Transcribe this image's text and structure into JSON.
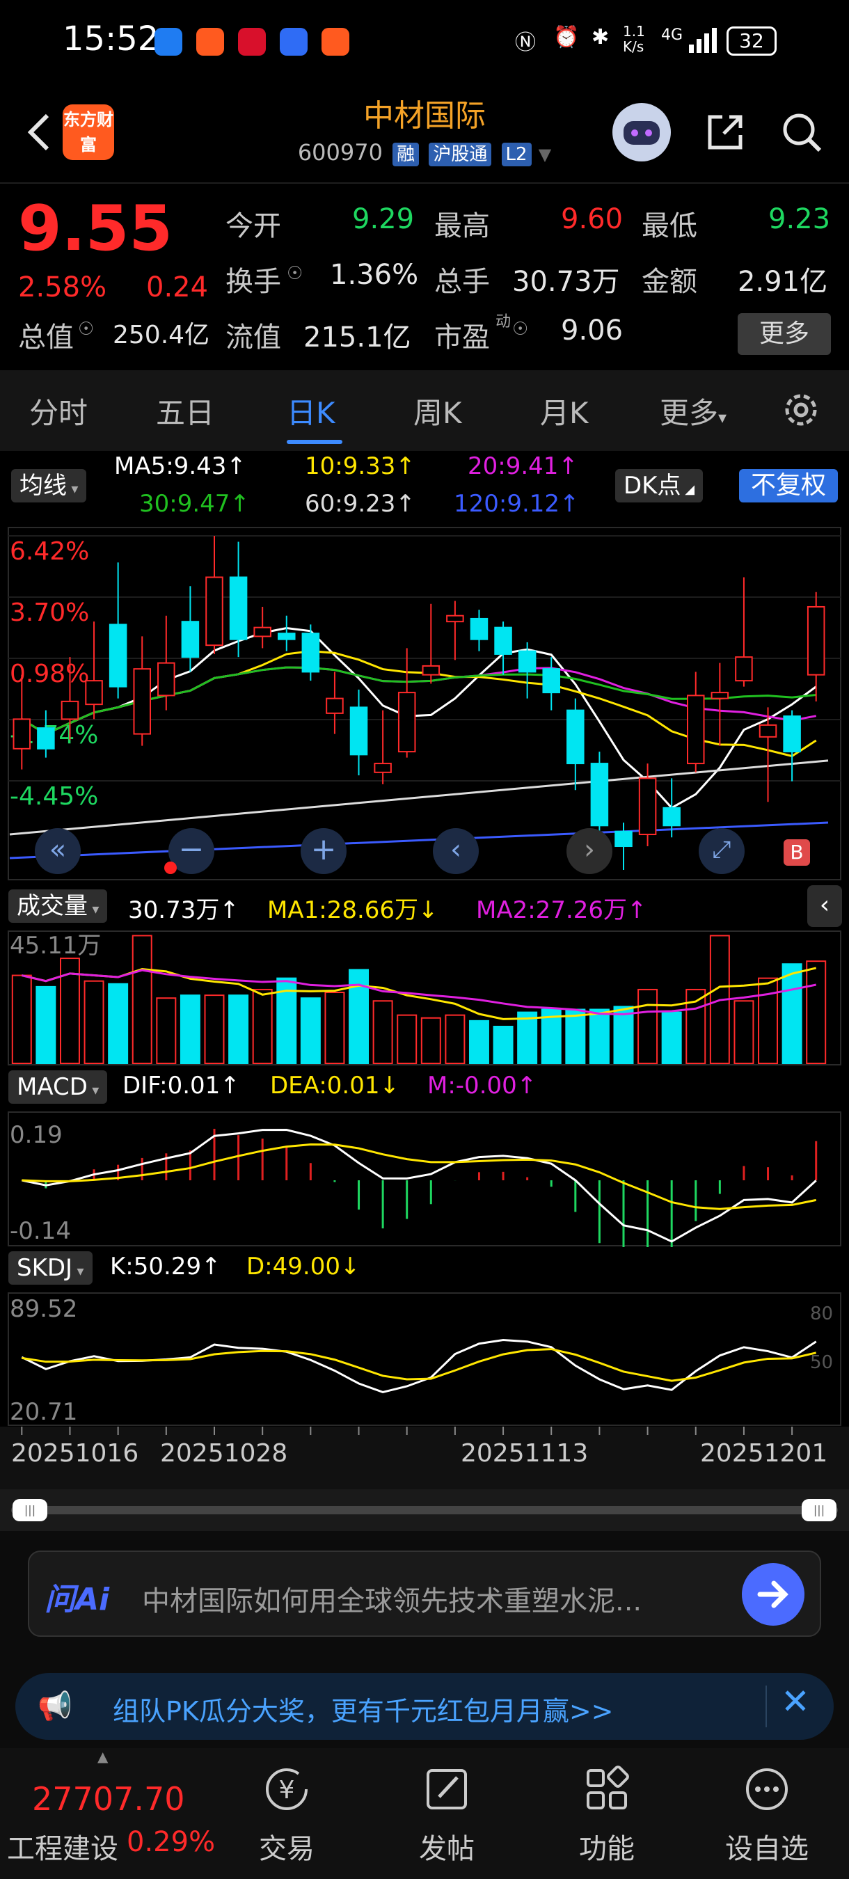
{
  "status": {
    "time": "15:52",
    "speed": "1.1\nK/s",
    "network": "4G",
    "battery": "32"
  },
  "header": {
    "logo_text": "东方财富",
    "title": "中材国际",
    "code": "600970",
    "tags": [
      "融",
      "沪股通",
      "L2"
    ]
  },
  "quote": {
    "price": "9.55",
    "change_pct": "2.58%",
    "change": "0.24",
    "open_label": "今开",
    "open": "9.29",
    "high_label": "最高",
    "high": "9.60",
    "low_label": "最低",
    "low": "9.23",
    "turnover_label": "换手",
    "turnover": "1.36%",
    "volume_label": "总手",
    "volume": "30.73万",
    "amount_label": "金额",
    "amount": "2.91亿",
    "mktcap_label": "总值",
    "mktcap": "250.4亿",
    "float_label": "流值",
    "float": "215.1亿",
    "pe_label": "市盈",
    "pe_sup": "动",
    "pe": "9.06",
    "more": "更多"
  },
  "tabs": [
    "分时",
    "五日",
    "日K",
    "周K",
    "月K",
    "更多"
  ],
  "ma": {
    "selector": "均线",
    "ma5": "MA5:9.43↑",
    "ma10": "10:9.33↑",
    "ma20": "20:9.41↑",
    "ma30": "30:9.47↑",
    "ma60": "60:9.23↑",
    "ma120": "120:9.12↑",
    "dk": "DK点",
    "fq": "不复权"
  },
  "kline": {
    "ylabels": [
      "6.42%",
      "3.70%",
      "0.98%",
      "-1.74%",
      "-4.45%"
    ],
    "candles": [
      {
        "o": 9.07,
        "c": 9.17,
        "h": 9.32,
        "l": 9.0
      },
      {
        "o": 9.14,
        "c": 9.07,
        "h": 9.2,
        "l": 9.04
      },
      {
        "o": 9.17,
        "c": 9.23,
        "h": 9.38,
        "l": 9.1
      },
      {
        "o": 9.22,
        "c": 9.3,
        "h": 9.5,
        "l": 9.17
      },
      {
        "o": 9.49,
        "c": 9.28,
        "h": 9.7,
        "l": 9.24
      },
      {
        "o": 9.12,
        "c": 9.34,
        "h": 9.45,
        "l": 9.08
      },
      {
        "o": 9.25,
        "c": 9.36,
        "h": 9.52,
        "l": 9.2
      },
      {
        "o": 9.5,
        "c": 9.38,
        "h": 9.62,
        "l": 9.33
      },
      {
        "o": 9.42,
        "c": 9.65,
        "h": 9.79,
        "l": 9.39
      },
      {
        "o": 9.65,
        "c": 9.44,
        "h": 9.77,
        "l": 9.38
      },
      {
        "o": 9.45,
        "c": 9.48,
        "h": 9.55,
        "l": 9.41
      },
      {
        "o": 9.46,
        "c": 9.44,
        "h": 9.52,
        "l": 9.4
      },
      {
        "o": 9.46,
        "c": 9.33,
        "h": 9.49,
        "l": 9.3
      },
      {
        "o": 9.19,
        "c": 9.24,
        "h": 9.33,
        "l": 9.12
      },
      {
        "o": 9.21,
        "c": 9.05,
        "h": 9.27,
        "l": 8.98
      },
      {
        "o": 8.99,
        "c": 9.02,
        "h": 9.2,
        "l": 8.95
      },
      {
        "o": 9.06,
        "c": 9.26,
        "h": 9.41,
        "l": 9.04
      },
      {
        "o": 9.32,
        "c": 9.35,
        "h": 9.56,
        "l": 9.29
      },
      {
        "o": 9.5,
        "c": 9.52,
        "h": 9.57,
        "l": 9.37
      },
      {
        "o": 9.51,
        "c": 9.44,
        "h": 9.54,
        "l": 9.4
      },
      {
        "o": 9.48,
        "c": 9.39,
        "h": 9.5,
        "l": 9.32
      },
      {
        "o": 9.4,
        "c": 9.33,
        "h": 9.43,
        "l": 9.24
      },
      {
        "o": 9.34,
        "c": 9.26,
        "h": 9.38,
        "l": 9.2
      },
      {
        "o": 9.2,
        "c": 9.02,
        "h": 9.24,
        "l": 8.93
      },
      {
        "o": 9.02,
        "c": 8.81,
        "h": 9.06,
        "l": 8.72
      },
      {
        "o": 8.79,
        "c": 8.74,
        "h": 8.82,
        "l": 8.66
      },
      {
        "o": 8.78,
        "c": 8.97,
        "h": 9.02,
        "l": 8.74
      },
      {
        "o": 8.87,
        "c": 8.81,
        "h": 8.97,
        "l": 8.77
      },
      {
        "o": 9.02,
        "c": 9.25,
        "h": 9.33,
        "l": 8.99
      },
      {
        "o": 9.24,
        "c": 9.26,
        "h": 9.36,
        "l": 9.08
      },
      {
        "o": 9.3,
        "c": 9.38,
        "h": 9.65,
        "l": 9.28
      },
      {
        "o": 9.11,
        "c": 9.15,
        "h": 9.21,
        "l": 8.89
      },
      {
        "o": 9.18,
        "c": 9.06,
        "h": 9.2,
        "l": 8.96
      },
      {
        "o": 9.32,
        "c": 9.55,
        "h": 9.6,
        "l": 9.23
      }
    ],
    "min": 8.66,
    "max": 9.79
  },
  "volume": {
    "selector": "成交量",
    "current": "30.73万↑",
    "ma1": "MA1:28.66万↓",
    "ma2": "MA2:27.26万↑",
    "ymax_label": "45.11万",
    "values": [
      31,
      27,
      37,
      29,
      28,
      45,
      23,
      24,
      24,
      24,
      26,
      30,
      23,
      25,
      33,
      22,
      17,
      16,
      17,
      15,
      13,
      18,
      19,
      19,
      19,
      20,
      26,
      18,
      26,
      45,
      22,
      30,
      35,
      36
    ],
    "max": 45.11
  },
  "macd": {
    "selector": "MACD",
    "dif": "DIF:0.01↑",
    "dea": "DEA:0.01↓",
    "m": "M:-0.00↑",
    "ytop": "0.19",
    "ybot": "-0.14"
  },
  "skdj": {
    "selector": "SKDJ",
    "k": "K:50.29↑",
    "d": "D:49.00↓",
    "ytop": "89.52",
    "ybot": "20.71",
    "r80": "80",
    "r50": "50"
  },
  "xaxis": [
    "20251016",
    "20251028",
    "20251113",
    "20251201"
  ],
  "ai": {
    "logo": "问Ai",
    "text": "中材国际如何用全球领先技术重塑水泥..."
  },
  "banner": {
    "text": "组队PK瓜分大奖，更有千元红包月月赢>>"
  },
  "bottom": {
    "index_value": "27707.70",
    "index_name": "工程建设",
    "index_pct": "0.29%",
    "items": [
      "交易",
      "发帖",
      "功能",
      "设自选"
    ]
  },
  "colors": {
    "up": "#ff2a2a",
    "down": "#1ed760",
    "down_candle": "#00e5f2",
    "accent": "#3d8bff"
  }
}
